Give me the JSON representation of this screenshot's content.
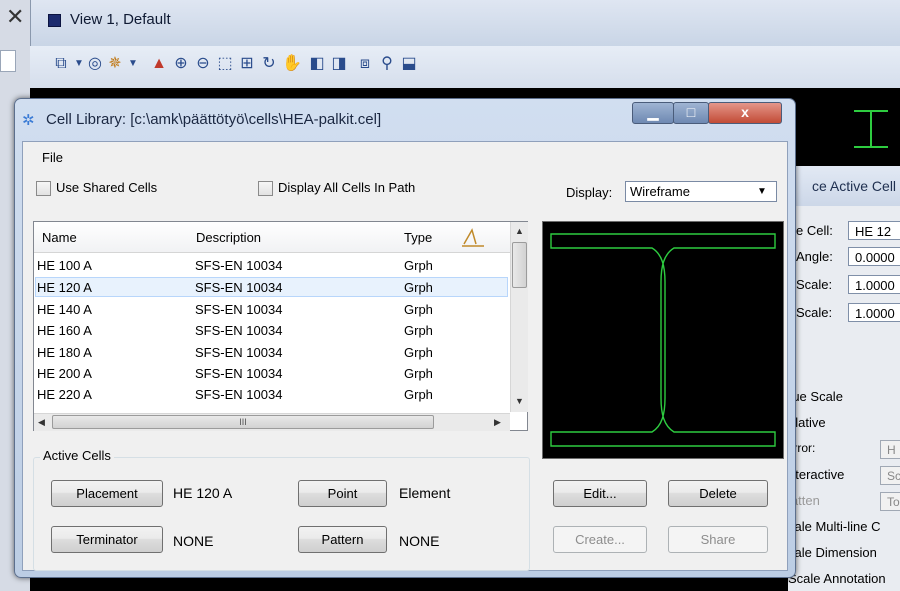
{
  "background": {
    "view_title": "View 1, Default",
    "active_placement_panel": {
      "title": "ce Active Cell",
      "fields": [
        {
          "label": "e Cell:",
          "value": "HE 12"
        },
        {
          "label": "Angle:",
          "value": "0.0000"
        },
        {
          "label": "Scale:",
          "value": "1.0000"
        },
        {
          "label": "Scale:",
          "value": "1.0000"
        }
      ],
      "options": [
        "rue Scale",
        "elative",
        "lirror:",
        "nteractive",
        "latten",
        "cale Multi-line C",
        "cale Dimension",
        "Scale Annotation"
      ],
      "option_buttons": [
        "H",
        "Sc",
        "To"
      ]
    }
  },
  "dialog": {
    "title": "Cell Library: [c:\\amk\\päättötyö\\cells\\HEA-palkit.cel]",
    "window_buttons": {
      "minimize": "▁",
      "maximize": "□",
      "close": "x"
    },
    "menu": {
      "file": "File"
    },
    "use_shared_cells": {
      "label": "Use Shared Cells",
      "checked": false
    },
    "display_all_cells": {
      "label": "Display All Cells In Path",
      "checked": false
    },
    "display": {
      "label": "Display:",
      "value": "Wireframe"
    },
    "list": {
      "columns": [
        "Name",
        "Description",
        "Type"
      ],
      "rows": [
        {
          "name": "HE 100 A",
          "description": "SFS-EN 10034",
          "type": "Grph",
          "selected": false
        },
        {
          "name": "HE 120 A",
          "description": "SFS-EN 10034",
          "type": "Grph",
          "selected": true
        },
        {
          "name": "HE 140 A",
          "description": "SFS-EN 10034",
          "type": "Grph",
          "selected": false
        },
        {
          "name": "HE 160 A",
          "description": "SFS-EN 10034",
          "type": "Grph",
          "selected": false
        },
        {
          "name": "HE 180 A",
          "description": "SFS-EN 10034",
          "type": "Grph",
          "selected": false
        },
        {
          "name": "HE 200 A",
          "description": "SFS-EN 10034",
          "type": "Grph",
          "selected": false
        },
        {
          "name": "HE 220 A",
          "description": "SFS-EN 10034",
          "type": "Grph",
          "selected": false
        }
      ],
      "hscroll_grip": "III"
    },
    "active_cells": {
      "group_label": "Active Cells",
      "placement_button": "Placement",
      "placement_value": "HE 120 A",
      "point_button": "Point",
      "point_value": "Element",
      "terminator_button": "Terminator",
      "terminator_value": "NONE",
      "pattern_button": "Pattern",
      "pattern_value": "NONE"
    },
    "actions": {
      "edit": "Edit...",
      "delete": "Delete",
      "create": "Create...",
      "share": "Share"
    }
  }
}
